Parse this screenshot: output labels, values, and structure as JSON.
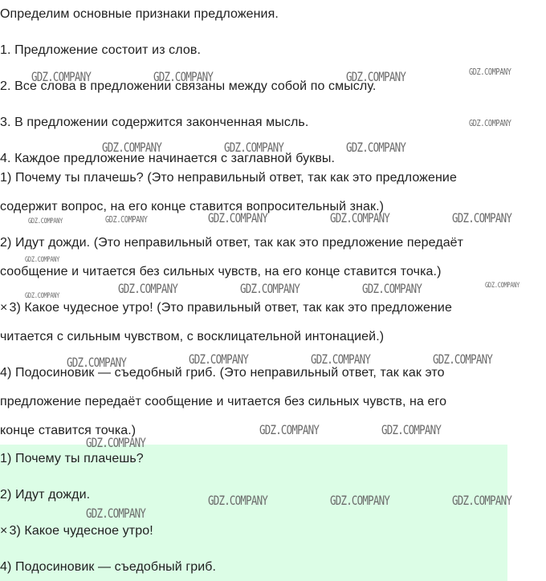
{
  "content": {
    "intro": "Определим основные признаки предложения.",
    "criteria": [
      "1. Предложение состоит из слов.",
      "2. Все слова в предложении связаны между собой по смыслу.",
      "3. В предложении содержится законченная мысль.",
      "4. Каждое предложение начинается с заглавной буквы."
    ],
    "options": [
      {
        "line1": "1) Почему ты плачешь? (Это неправильный ответ, так как это предложение",
        "line2": "содержит вопрос, на его конце ставится вопросительный знак.)"
      },
      {
        "line1": "2) Идут дожди. (Это неправильный ответ, так как это предложение передаёт",
        "line2": "сообщение и читается без сильных чувств, на его конце ставится точка.)"
      },
      {
        "mark": "×",
        "line1": "3) Какое чудесное утро! (Это правильный ответ, так как это предложение",
        "line2": "читается с сильным чувством, с восклицательной интонацией.)"
      },
      {
        "line1": "4) Подосиновик — съедобный гриб. (Это неправильный ответ, так как это",
        "line2": "предложение передаёт сообщение и читается без сильных чувств, на его",
        "line3": "конце ставится точка.)"
      }
    ]
  },
  "answer": {
    "background_color": "#dcfde6",
    "items": [
      "1) Почему ты плачешь?",
      "2) Идут дожди.",
      "3) Какое чудесное утро!",
      "4) Подосиновик — съедобный гриб."
    ],
    "selected_mark": "×"
  },
  "watermark": {
    "text": "GDZ.COMPANY"
  }
}
